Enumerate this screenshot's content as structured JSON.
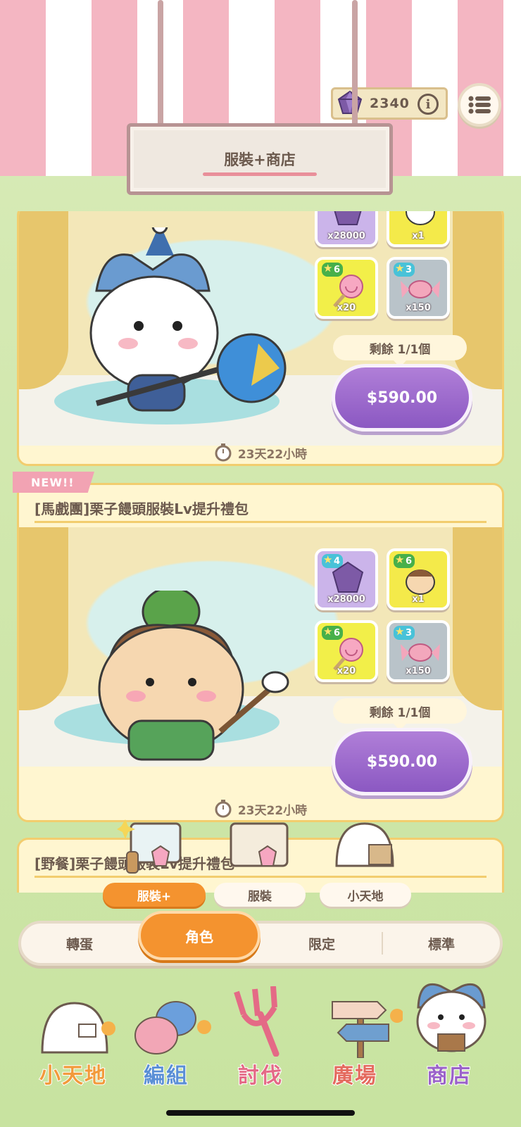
{
  "header": {
    "gem_count": "2340",
    "info_label": "i",
    "sign_title": "服裝+商店"
  },
  "cards": [
    {
      "title": "",
      "rewards": [
        {
          "qty": "x28000",
          "stars": "",
          "color": "purple"
        },
        {
          "qty": "x1",
          "stars": "",
          "color": "yellow"
        },
        {
          "qty": "x20",
          "stars": "6",
          "color": "green"
        },
        {
          "qty": "x150",
          "stars": "3",
          "color": "grey"
        }
      ],
      "remaining": "剩餘 1/1個",
      "price": "$590.00",
      "timer": "23天22小時"
    },
    {
      "badge": "NEW!!",
      "title": "[馬戲團]栗子饅頭服裝Lv提升禮包",
      "rewards": [
        {
          "qty": "x28000",
          "stars": "4",
          "color": "purple"
        },
        {
          "qty": "x1",
          "stars": "6",
          "color": "yellow"
        },
        {
          "qty": "x20",
          "stars": "6",
          "color": "green"
        },
        {
          "qty": "x150",
          "stars": "3",
          "color": "grey"
        }
      ],
      "remaining": "剩餘 1/1個",
      "price": "$590.00",
      "timer": "23天22小時"
    },
    {
      "title": "[野餐]栗子饅頭服裝Lv提升禮包"
    }
  ],
  "subtabs": [
    {
      "label": "服裝+",
      "active": true
    },
    {
      "label": "服裝",
      "active": false
    },
    {
      "label": "小天地",
      "active": false
    }
  ],
  "segments": [
    {
      "label": "轉蛋",
      "active": false
    },
    {
      "label": "角色",
      "active": true
    },
    {
      "label": "限定",
      "active": false
    },
    {
      "label": "標準",
      "active": false
    }
  ],
  "bottom_nav": [
    {
      "label": "小天地",
      "color": "#f29a3b"
    },
    {
      "label": "編組",
      "color": "#5a8fd6"
    },
    {
      "label": "討伐",
      "color": "#e46a86"
    },
    {
      "label": "廣場",
      "color": "#e46a5e"
    },
    {
      "label": "商店",
      "color": "#9a62c9"
    }
  ],
  "colors": {
    "accent_orange": "#f4932f",
    "buy_purple": "#9b66cc",
    "card_border": "#f2cd6e",
    "awning_pink": "#f4b6c2"
  }
}
